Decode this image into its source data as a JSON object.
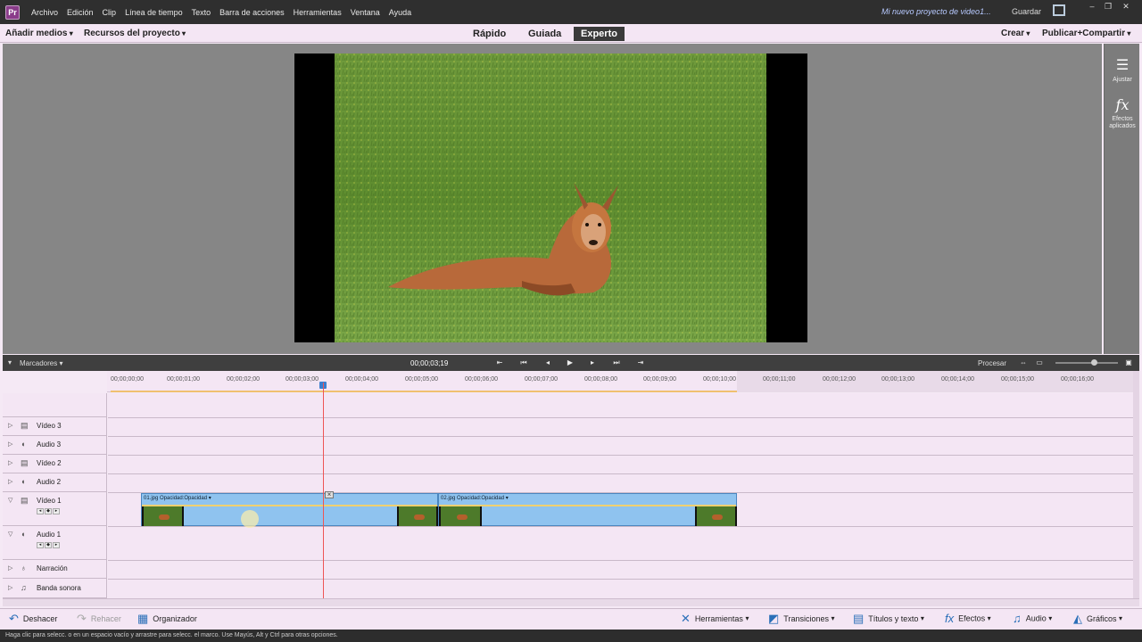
{
  "menubar": {
    "items": [
      "Archivo",
      "Edición",
      "Clip",
      "Línea de tiempo",
      "Texto",
      "Barra de acciones",
      "Herramientas",
      "Ventana",
      "Ayuda"
    ],
    "project_title": "Mi nuevo proyecto de video1...",
    "save": "Guardar"
  },
  "topbar": {
    "add_media": "Añadir medios",
    "project_assets": "Recursos del proyecto",
    "modes": [
      "Rápido",
      "Guiada",
      "Experto"
    ],
    "active_mode": "Experto",
    "create": "Crear",
    "publish": "Publicar+Compartir"
  },
  "right_panel": {
    "adjust": "Ajustar",
    "applied_effects": "Efectos aplicados"
  },
  "timeline": {
    "markers": "Marcadores",
    "timecode": "00;00;03;19",
    "render": "Procesar",
    "ruler": [
      "00;00;00;00",
      "00;00;01;00",
      "00;00;02;00",
      "00;00;03;00",
      "00;00;04;00",
      "00;00;05;00",
      "00;00;06;00",
      "00;00;07;00",
      "00;00;08;00",
      "00;00;09;00",
      "00;00;10;00",
      "00;00;11;00",
      "00;00;12;00",
      "00;00;13;00",
      "00;00;14;00",
      "00;00;15;00",
      "00;00;16;00"
    ],
    "tracks": [
      "Vídeo 3",
      "Audio 3",
      "Vídeo 2",
      "Audio 2",
      "Vídeo 1",
      "Audio 1",
      "Narración",
      "Banda sonora"
    ],
    "clips": [
      {
        "label": "01.jpg Opacidad:Opacidad ▾"
      },
      {
        "label": "02.jpg Opacidad:Opacidad ▾"
      }
    ]
  },
  "bottombar": {
    "undo": "Deshacer",
    "redo": "Rehacer",
    "organizer": "Organizador",
    "tools": "Herramientas",
    "transitions": "Transiciones",
    "titles": "Títulos y texto",
    "effects": "Efectos",
    "audio": "Audio",
    "graphics": "Gráficos"
  },
  "status": "Haga clic para selecc. o en un espacio vacío y arrastre para selecc. el marco. Use Mayús, Alt y Ctrl para otras opciones."
}
